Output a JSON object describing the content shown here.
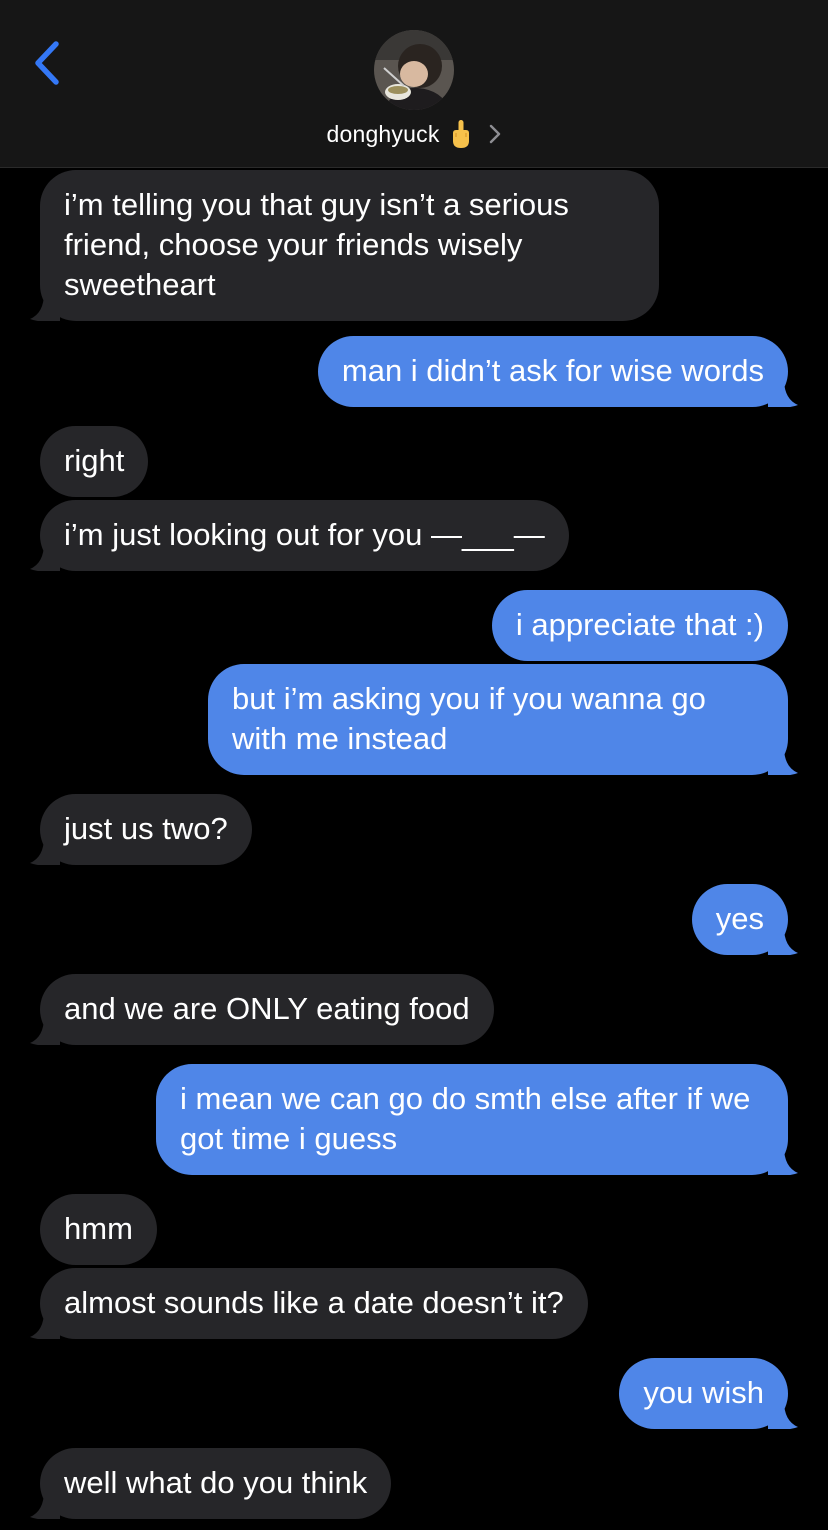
{
  "header": {
    "contact_name": "donghyuck",
    "name_emoji": "middle-finger-emoji",
    "back_icon": "chevron-left-icon",
    "detail_icon": "chevron-right-icon",
    "accent_color": "#3478f6"
  },
  "colors": {
    "incoming_bubble": "#262629",
    "outgoing_bubble": "#4f86e8",
    "background": "#000000"
  },
  "messages": [
    {
      "direction": "incoming",
      "text": "i’m telling you that guy isn’t a serious friend, choose your friends wisely sweetheart"
    },
    {
      "direction": "outgoing",
      "text": "man i didn’t ask for wise words"
    },
    {
      "direction": "incoming",
      "text": "right"
    },
    {
      "direction": "incoming",
      "text": "i’m just looking out for you —___—"
    },
    {
      "direction": "outgoing",
      "text": "i appreciate that :)"
    },
    {
      "direction": "outgoing",
      "text": "but i’m asking you if you wanna go with me instead"
    },
    {
      "direction": "incoming",
      "text": "just us two?"
    },
    {
      "direction": "outgoing",
      "text": "yes"
    },
    {
      "direction": "incoming",
      "text": "and we are ONLY eating food"
    },
    {
      "direction": "outgoing",
      "text": "i mean we can go do smth else after if we got time i guess"
    },
    {
      "direction": "incoming",
      "text": "hmm"
    },
    {
      "direction": "incoming",
      "text": "almost sounds like a date doesn’t it?"
    },
    {
      "direction": "outgoing",
      "text": "you wish"
    },
    {
      "direction": "incoming",
      "text": "well what do you think"
    }
  ]
}
